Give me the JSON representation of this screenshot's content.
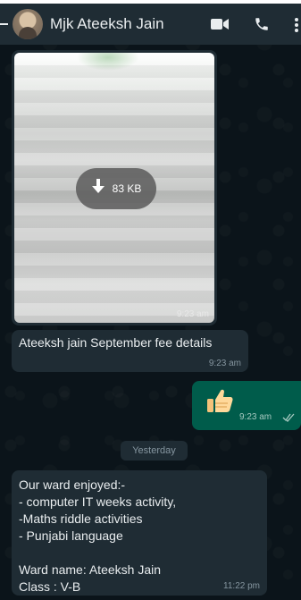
{
  "header": {
    "contact_name": "Mjk Ateeksh Jain",
    "icons": [
      "back-arrow-icon",
      "avatar",
      "video-call-icon",
      "phone-call-icon",
      "more-options-icon"
    ]
  },
  "messages": {
    "image": {
      "download_size": "83 KB",
      "time": "9:23 am"
    },
    "caption": {
      "text": "Ateeksh jain September fee details",
      "time": "9:23 am"
    },
    "sent_sticker": {
      "icon": "thumbs-up-icon",
      "time": "9:23 am",
      "status": "read"
    },
    "date_separator": "Yesterday",
    "text_message": {
      "lines": [
        "Our ward enjoyed:-",
        "- computer IT weeks activity,",
        "-Maths riddle activities",
        "- Punjabi language",
        "",
        "Ward name: Ateeksh Jain",
        "Class : V-B"
      ],
      "time": "11:22 pm"
    }
  },
  "colors": {
    "background": "#0b141a",
    "header": "#1f2c34",
    "incoming_bubble": "#1f2c34",
    "outgoing_bubble": "#005c4b",
    "text": "#e9edef",
    "meta": "#8696a0"
  }
}
